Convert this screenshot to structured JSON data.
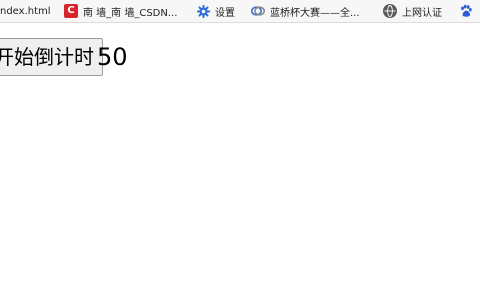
{
  "bookmarks": [
    {
      "label": "ndex.html",
      "icon": "file-icon"
    },
    {
      "label": "南 墙_南 墙_CSDN...",
      "icon": "csdn-icon"
    },
    {
      "label": "设置",
      "icon": "gear-icon"
    },
    {
      "label": "蓝桥杯大赛——全...",
      "icon": "lanqiao-icon"
    },
    {
      "label": "上网认证",
      "icon": "globe-icon"
    },
    {
      "label": "",
      "icon": "baidu-paw-icon"
    }
  ],
  "main": {
    "button_label": "开始倒计时",
    "countdown_value": "50"
  },
  "colors": {
    "csdn_red": "#d7262b",
    "gear_blue": "#2e6fd8",
    "baidu_blue": "#2e5bd8"
  }
}
